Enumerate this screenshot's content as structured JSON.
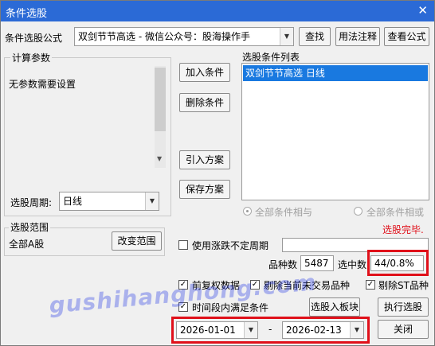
{
  "window": {
    "title": "条件选股",
    "close_glyph": "✕"
  },
  "formula": {
    "label": "条件选股公式",
    "value": "双剑节节高选  -  微信公众号：股海操作手",
    "find_button": "查找",
    "usage_button": "用法注释",
    "view_button": "查看公式"
  },
  "params": {
    "group_title": "计算参数",
    "text": "无参数需要设置",
    "period_label": "选股周期:",
    "period_value": "日线"
  },
  "actions": {
    "add": "加入条件",
    "delete": "删除条件",
    "import": "引入方案",
    "save": "保存方案"
  },
  "conditions": {
    "title": "选股条件列表",
    "items": [
      "双剑节节高选  日线"
    ]
  },
  "logic": {
    "and_label": "全部条件相与",
    "or_label": "全部条件相或"
  },
  "status": {
    "text": "选股完毕."
  },
  "scope": {
    "group_title": "选股范围",
    "value": "全部A股",
    "change_button": "改变范围"
  },
  "options": {
    "limit_period_label": "使用涨跌不定周期",
    "species_label": "品种数",
    "species_value": "5487",
    "selected_label": "选中数",
    "selected_value": "44/0.8%",
    "fq_label": "前复权数据",
    "exclude_untraded_label": "剔除当前未交易品种",
    "exclude_st_label": "剔除ST品种",
    "time_range_label": "时间段内满足条件"
  },
  "dates": {
    "start": "2026-01-01",
    "separator": "-",
    "end": "2026-02-13"
  },
  "bottom": {
    "to_block": "选股入板块",
    "execute": "执行选股",
    "close": "关闭"
  },
  "watermark": "gushihanghong.com",
  "colors": {
    "title_bar": "#2b6ad6",
    "selection": "#1979e0",
    "status_red": "#e0101a",
    "highlight_box": "#e0101a"
  }
}
